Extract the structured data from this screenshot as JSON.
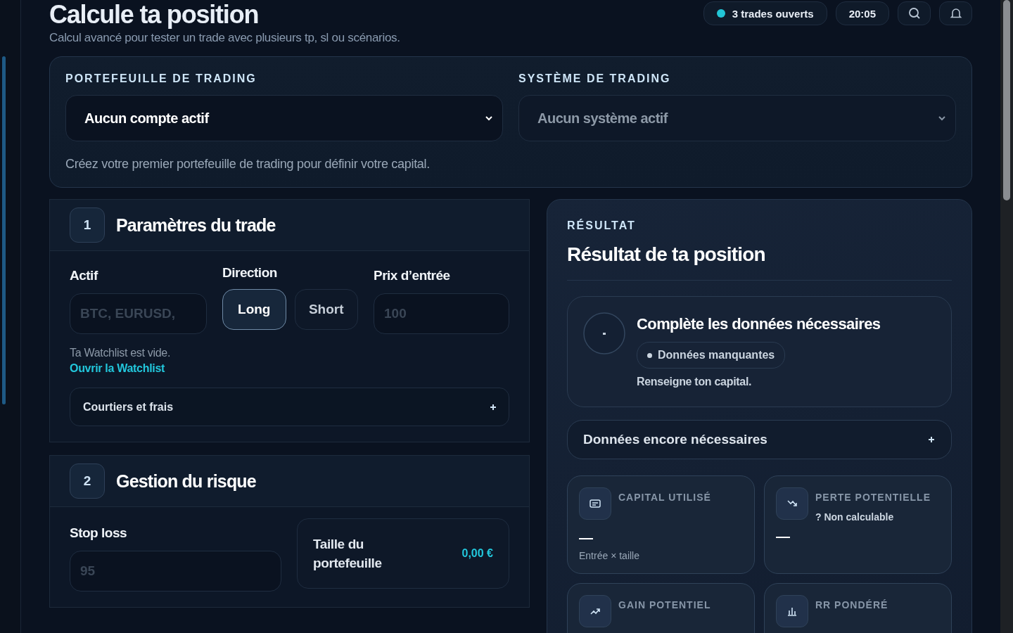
{
  "header": {
    "title": "Calcule ta position",
    "subtitle": "Calcul avancé pour tester un trade avec plusieurs tp, sl ou scénarios.",
    "open_trades": {
      "label": "3 trades ouverts",
      "color": "#22c5d6"
    },
    "time": "20:05"
  },
  "portfolio": {
    "fields": [
      {
        "label": "PORTEFEUILLE DE TRADING",
        "value": "Aucun compte actif",
        "disabled": false
      },
      {
        "label": "SYSTÈME DE TRADING",
        "value": "Aucun système actif",
        "disabled": true
      }
    ],
    "hint": "Créez votre premier portefeuille de trading pour définir votre capital."
  },
  "params": {
    "number": "1",
    "title": "Paramètres du trade",
    "asset": {
      "label": "Actif",
      "placeholder": "BTC, EURUSD,"
    },
    "direction": {
      "label": "Direction",
      "options": [
        {
          "label": "Long",
          "selected": true
        },
        {
          "label": "Short",
          "selected": false
        }
      ]
    },
    "entry": {
      "label": "Prix d’entrée",
      "placeholder": "100"
    },
    "watchlist_note": "Ta Watchlist est vide.",
    "watchlist_link": "Ouvrir la Watchlist",
    "brokers": {
      "label": "Courtiers et frais",
      "expanded": false
    }
  },
  "risk": {
    "number": "2",
    "title": "Gestion du risque",
    "stop_loss": {
      "label": "Stop loss",
      "placeholder": "95"
    },
    "portfolio_size": {
      "label": "Taille du portefeuille",
      "value": "0,00 €"
    }
  },
  "result": {
    "eyebrow": "RÉSULTAT",
    "title": "Résultat de ta position",
    "status": {
      "title": "Complète les données nécessaires",
      "badge": "Données manquantes",
      "message": "Renseigne ton capital."
    },
    "needed": {
      "label": "Données encore nécessaires",
      "expanded": false
    },
    "stats": [
      {
        "label": "CAPITAL UTILISÉ",
        "value": "—",
        "caption": "Entrée × taille"
      },
      {
        "label": "PERTE POTENTIELLE",
        "note": "? Non calculable",
        "value": "—"
      },
      {
        "label": "GAIN POTENTIEL"
      },
      {
        "label": "RR PONDÉRÉ"
      }
    ]
  }
}
